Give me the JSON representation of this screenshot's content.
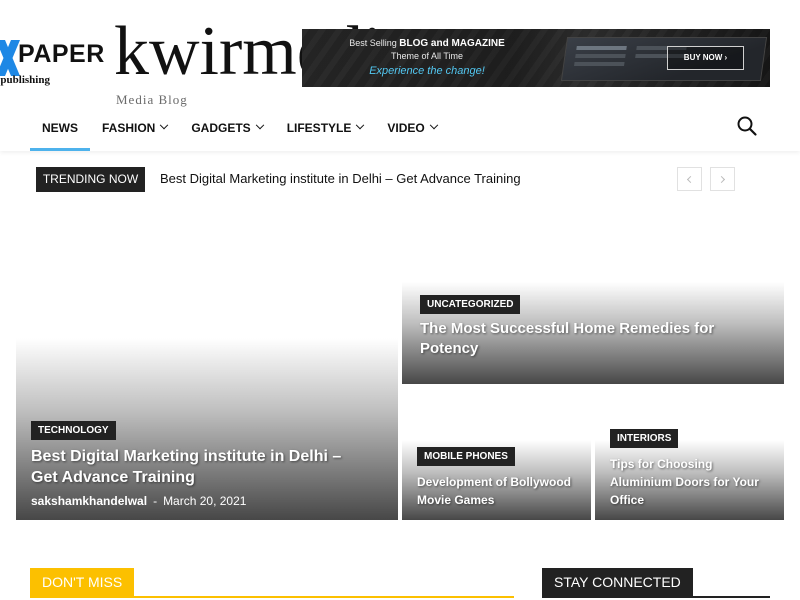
{
  "logo": {
    "mark": "X-mark-icon",
    "name": "PAPER",
    "tagline": "f publishing"
  },
  "site": {
    "title": "kwirmedia",
    "tagline": "Media Blog"
  },
  "banner": {
    "line1_prefix": "Best Selling ",
    "line1_bold": "BLOG and MAGAZINE",
    "line2": "Theme of All Time",
    "line3": "Experience the change!",
    "button_label": "BUY NOW ›"
  },
  "nav": {
    "items": [
      {
        "label": "NEWS",
        "has_dropdown": false,
        "active": true
      },
      {
        "label": "FASHION",
        "has_dropdown": true
      },
      {
        "label": "GADGETS",
        "has_dropdown": true
      },
      {
        "label": "LIFESTYLE",
        "has_dropdown": true
      },
      {
        "label": "VIDEO",
        "has_dropdown": true
      }
    ],
    "search_icon": "search-icon",
    "accent_color": "#4db2ec"
  },
  "trending": {
    "badge": "TRENDING NOW",
    "headline": "Best Digital Marketing institute in Delhi – Get Advance Training",
    "prev_icon": "chevron-left-icon",
    "next_icon": "chevron-right-icon"
  },
  "grid": {
    "main": {
      "category": "TECHNOLOGY",
      "title": "Best Digital Marketing institute in Delhi – Get Advance Training",
      "author": "sakshamkhandelwal",
      "separator": "-",
      "date": "March 20, 2021"
    },
    "top_right": {
      "category": "UNCATEGORIZED",
      "title": "The Most Successful Home Remedies for Potency"
    },
    "bottom_left": {
      "category": "MOBILE PHONES",
      "title": "Development of Bollywood Movie Games"
    },
    "bottom_right": {
      "category": "INTERIORS",
      "title": "Tips for Choosing Aluminium Doors for Your Office"
    }
  },
  "sections": {
    "dont_miss": {
      "title": "DON'T MISS",
      "color": "#fcc000"
    },
    "stay_connected": {
      "title": "STAY CONNECTED",
      "color": "#222222"
    }
  }
}
